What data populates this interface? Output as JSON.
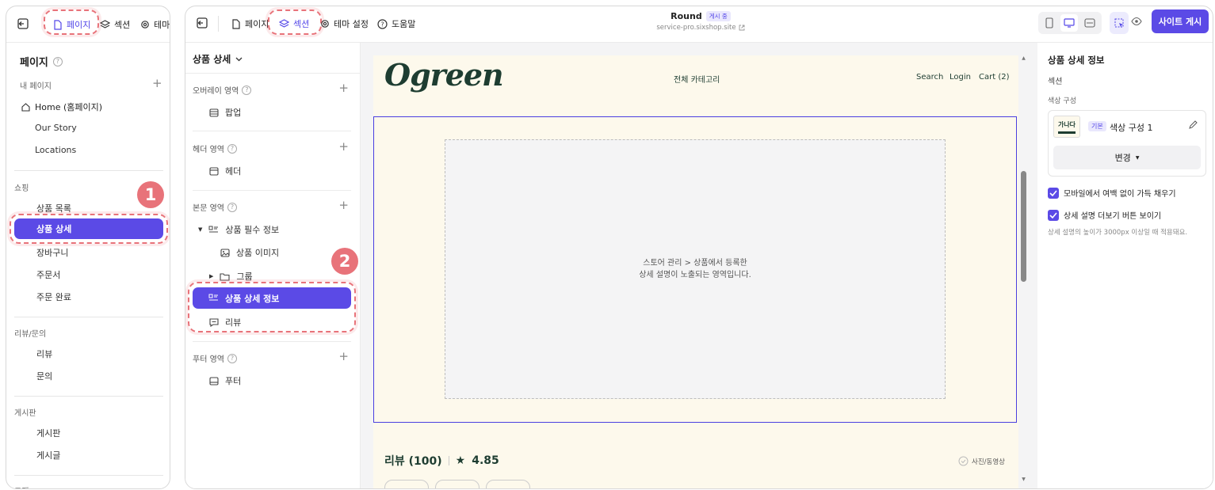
{
  "left_panel": {
    "toolbar": {
      "pages": "페이지",
      "sections": "섹션",
      "theme": "테마"
    },
    "title": "페이지",
    "my_pages": {
      "label": "내 페이지",
      "items": [
        "Home (홈페이지)",
        "Our Story",
        "Locations"
      ]
    },
    "shopping": {
      "label": "쇼핑",
      "items": [
        "상품 목록",
        "상품 상세",
        "장바구니",
        "주문서",
        "주문 완료"
      ],
      "selected": "상품 상세"
    },
    "review_qna": {
      "label": "리뷰/문의",
      "items": [
        "리뷰",
        "문의"
      ]
    },
    "board": {
      "label": "게시판",
      "items": [
        "게시판",
        "게시글"
      ]
    },
    "next_group_partial": "고객"
  },
  "markers": [
    "1",
    "2"
  ],
  "main_toolbar": {
    "pages": "페이지",
    "sections": "섹션",
    "theme": "테마 설정",
    "help": "도움말",
    "site_name": "Round",
    "status_badge": "게시 중",
    "site_url": "service-pro.sixshop.site",
    "publish_button": "사이트 게시"
  },
  "section_panel": {
    "page_selector": "상품 상세",
    "overlay": {
      "label": "오버레이 영역",
      "items": [
        "팝업"
      ]
    },
    "header": {
      "label": "헤더 영역",
      "items": [
        "헤더"
      ]
    },
    "body": {
      "label": "본문 영역",
      "group": "상품 필수 정보",
      "children": [
        "상품 이미지",
        "그룹"
      ],
      "selected": "상품 상세 정보",
      "after": "리뷰"
    },
    "footer": {
      "label": "푸터 영역",
      "items": [
        "푸터"
      ]
    }
  },
  "preview": {
    "logo": "Ogreen",
    "nav_center": "전체 카테고리",
    "nav_right": [
      "Search",
      "Login",
      "Cart (2)"
    ],
    "placeholder_line1": "스토어 관리 > 상품에서 등록한",
    "placeholder_line2": "상세 설명이 노출되는 영역입니다.",
    "review_title": "리뷰 (100)",
    "rating": "4.85",
    "photo_filter": "사진/동영상"
  },
  "settings_panel": {
    "title": "상품 상세 정보",
    "section_label": "섹션",
    "color_label": "색상 구성",
    "color_swatch_text": "가나다",
    "color_badge": "기본",
    "color_name": "색상 구성 1",
    "change_button": "변경",
    "option1": "모바일에서 여백 없이 가득 채우기",
    "option2": "상세 설명 더보기 버튼 보이기",
    "option2_hint": "상세 설명의 높이가 3000px 이상일 때 적용돼요."
  },
  "colors": {
    "accent": "#5b4ae6",
    "highlight": "#e8737a",
    "store_bg": "#fdf9ec",
    "logo": "#1e3d31"
  }
}
